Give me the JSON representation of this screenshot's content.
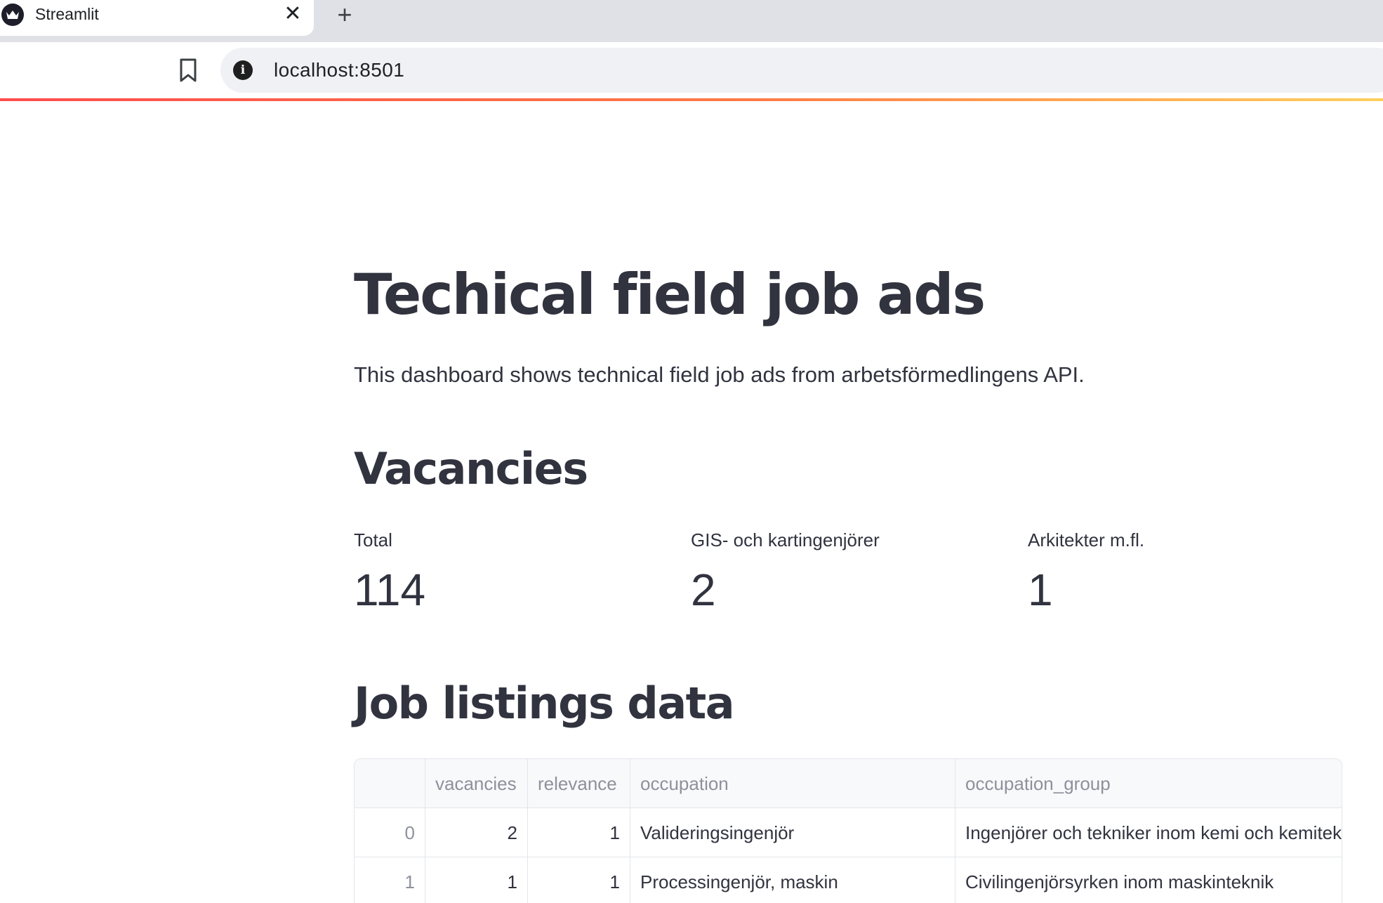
{
  "browser": {
    "tab_title": "Streamlit",
    "tab_close": "✕",
    "new_tab": "+",
    "url": "localhost:8501"
  },
  "page": {
    "title": "Techical field job ads",
    "description": "This dashboard shows technical field job ads from arbetsförmedlingens API.",
    "vacancies_heading": "Vacancies",
    "metrics": [
      {
        "label": "Total",
        "value": "114"
      },
      {
        "label": "GIS- och kartingenjörer",
        "value": "2"
      },
      {
        "label": "Arkitekter m.fl.",
        "value": "1"
      }
    ],
    "table_heading": "Job listings data",
    "table": {
      "columns": [
        "",
        "vacancies",
        "relevance",
        "occupation",
        "occupation_group"
      ],
      "rows": [
        [
          "0",
          "2",
          "1",
          "Valideringsingenjör",
          "Ingenjörer och tekniker inom kemi och kemiteknik"
        ],
        [
          "1",
          "1",
          "1",
          "Processingenjör, maskin",
          "Civilingenjörsyrken inom maskinteknik"
        ]
      ]
    }
  }
}
